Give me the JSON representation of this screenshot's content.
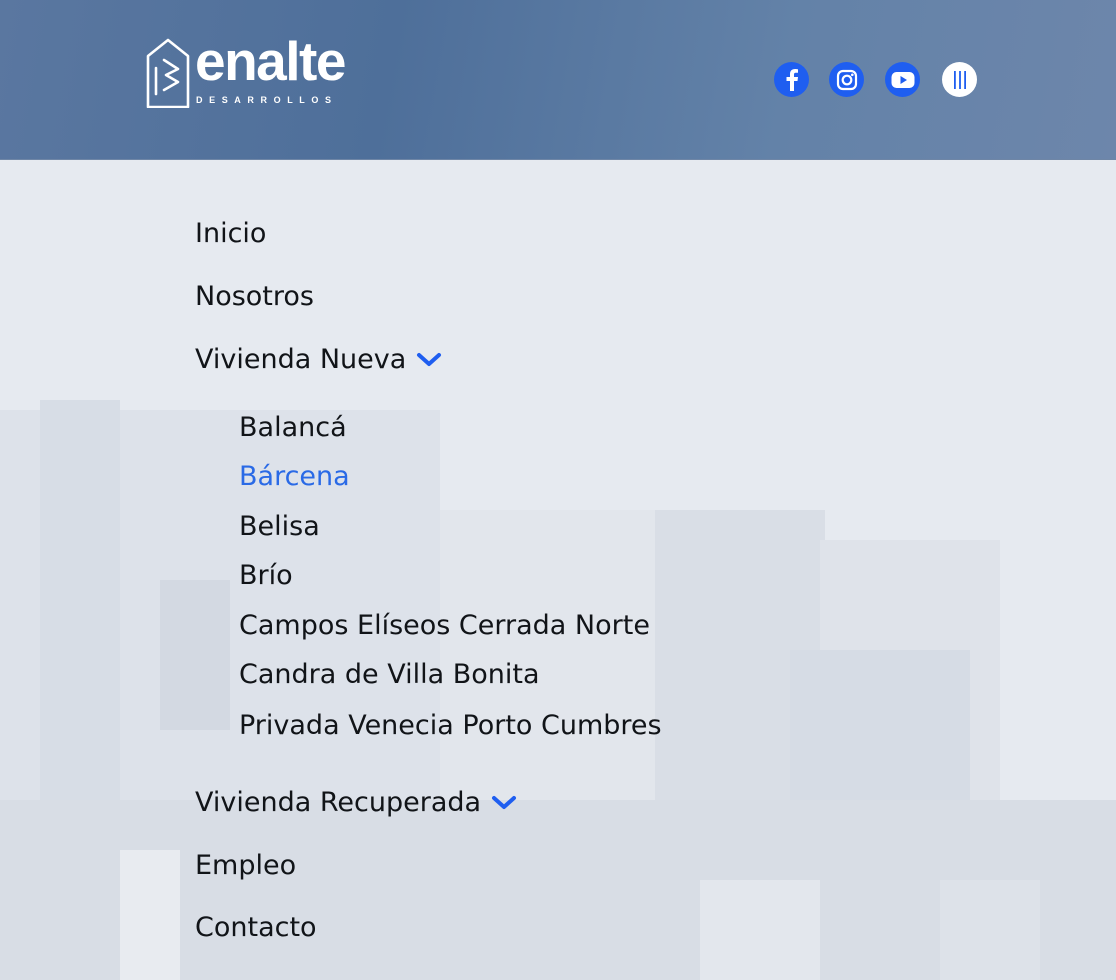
{
  "brand": {
    "name": "enalte",
    "subtitle": "DESARROLLOS"
  },
  "social": [
    {
      "icon": "facebook-icon"
    },
    {
      "icon": "instagram-icon"
    },
    {
      "icon": "youtube-icon"
    },
    {
      "icon": "menu-lines-icon"
    }
  ],
  "colors": {
    "accent": "#1f5ef0",
    "active_link": "#2a6ae6",
    "header": "#4e6f9a",
    "text": "#111418"
  },
  "nav": {
    "items": [
      {
        "label": "Inicio"
      },
      {
        "label": "Nosotros"
      },
      {
        "label": "Vivienda Nueva",
        "expanded": true
      },
      {
        "label": "Vivienda Recuperada"
      },
      {
        "label": "Empleo"
      },
      {
        "label": "Contacto"
      }
    ],
    "vivienda_nueva": [
      {
        "label": "Balancá"
      },
      {
        "label": "Bárcena",
        "active": true
      },
      {
        "label": "Belisa"
      },
      {
        "label": "Brío"
      },
      {
        "label": "Campos Elíseos Cerrada Norte"
      },
      {
        "label": "Candra de Villa Bonita"
      },
      {
        "label": "Privada Venecia Porto Cumbres"
      }
    ]
  }
}
